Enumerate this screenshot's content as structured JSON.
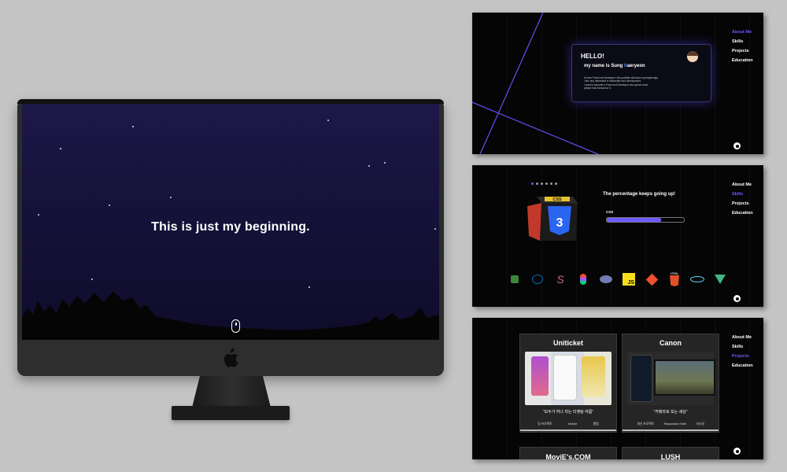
{
  "monitor": {
    "headline": "This is just my beginning.",
    "icons": [
      "mouse-scroll-icon",
      "apple-logo-icon"
    ]
  },
  "nav": {
    "items": [
      "About Me",
      "Skills",
      "Projects",
      "Education"
    ]
  },
  "about": {
    "greeting": "HELLO!",
    "name_prefix": "my name is Sung ",
    "name_highlight": "h",
    "name_suffix": "aeryeon",
    "body_lines": [
      "Ve-ime Front-end Developer. this portfolio will show my beginnings",
      "I am very interested in interactive and development.",
      "I want to become a Front-end Developer who grows more.",
      "please look forward to it."
    ]
  },
  "skills": {
    "heading": "The percentage keeps going up!",
    "current_skill": "CSS",
    "progress": 0.7,
    "cube_label": "CSS",
    "accent": "#6d5bff",
    "tech_icons": [
      "node-icon",
      "jquery-icon",
      "sass-icon",
      "figma-icon",
      "php-icon",
      "js-icon",
      "git-icon",
      "html5-icon",
      "react-icon",
      "vue-icon"
    ],
    "tech_labels": {
      "js": "JS",
      "html": "HTML"
    }
  },
  "projects": {
    "items": [
      {
        "title": "Uniticket",
        "quote": "\"모두가 하나 되는 티켓팅 여름\"",
        "tags": [
          "팀 프로젝트",
          "Mobile",
          "웹앱"
        ]
      },
      {
        "title": "Canon",
        "quote": "\"카메라로 보는 세상\"",
        "tags": [
          "개인 프로젝트",
          "Responsive Web",
          "리뉴얼"
        ]
      }
    ],
    "more": [
      "MoviE's.COM",
      "LUSH"
    ]
  }
}
